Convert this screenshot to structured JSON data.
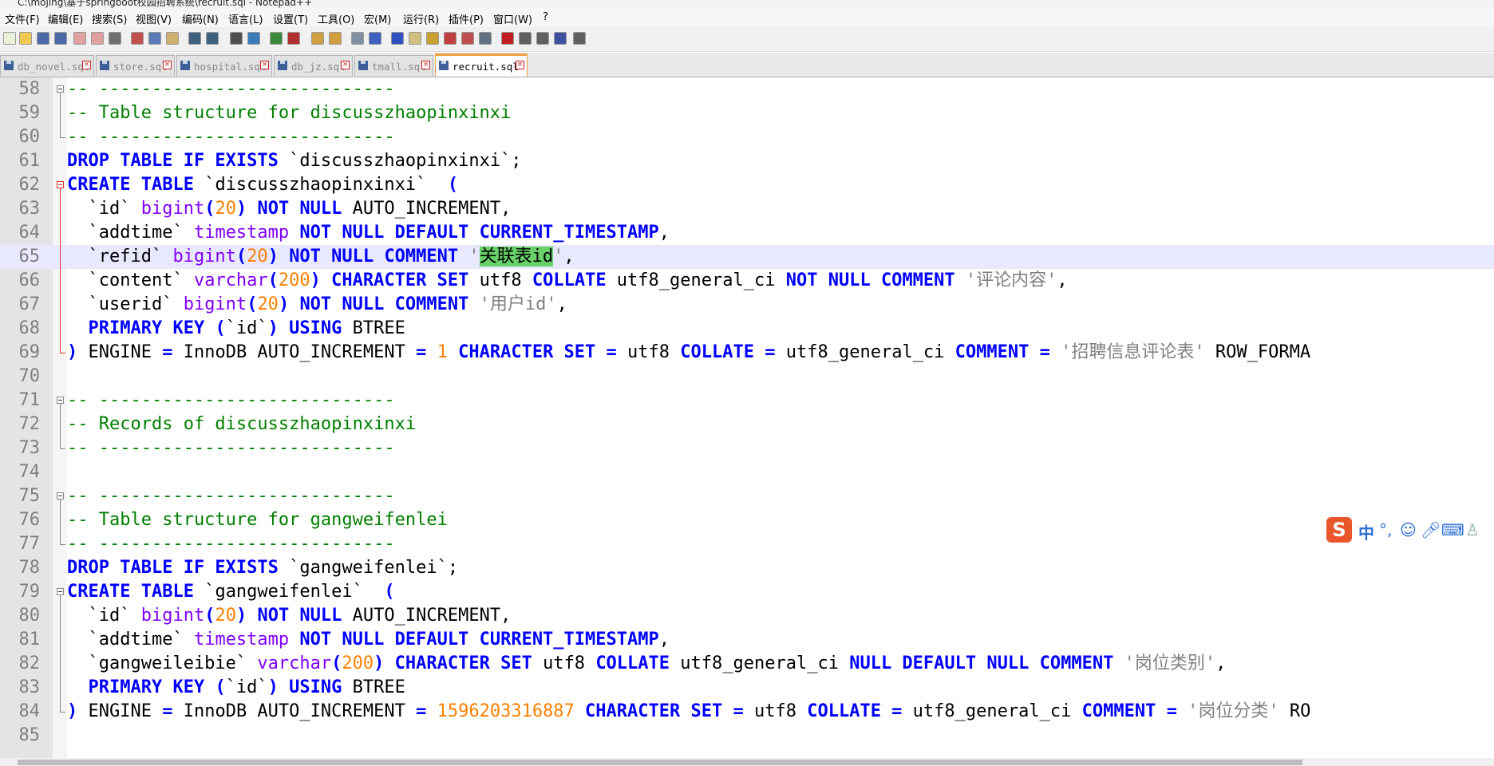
{
  "window": {
    "title": "C:\\mojing\\基于springboot校园招聘系统\\recruit.sql - Notepad++"
  },
  "menu": [
    "文件(F)",
    "编辑(E)",
    "搜索(S)",
    "视图(V)",
    "编码(N)",
    "语言(L)",
    "设置(T)",
    "工具(O)",
    "宏(M)",
    "运行(R)",
    "插件(P)",
    "窗口(W)",
    "?"
  ],
  "toolbar": {
    "icons": [
      "new-file-icon",
      "open-file-icon",
      "save-icon",
      "save-all-icon",
      "close-icon",
      "close-all-icon",
      "print-icon",
      "cut-icon",
      "copy-icon",
      "paste-icon",
      "undo-icon",
      "redo-icon",
      "find-icon",
      "replace-icon",
      "zoom-in-icon",
      "zoom-out-icon",
      "sync-vertical-icon",
      "sync-horizontal-icon",
      "word-wrap-icon",
      "show-all-chars-icon",
      "indent-guide-icon",
      "language-icon",
      "function-list-icon",
      "doc-map-icon",
      "folder-icon",
      "monitor-icon",
      "record-macro-icon",
      "stop-macro-icon",
      "play-macro-icon",
      "run-macro-multiple-icon",
      "save-macro-icon"
    ]
  },
  "tabs": [
    {
      "label": "db_novel.sql",
      "active": false
    },
    {
      "label": "store.sql",
      "active": false
    },
    {
      "label": "hospital.sql",
      "active": false
    },
    {
      "label": "db_jz.sql",
      "active": false
    },
    {
      "label": "tmall.sql",
      "active": false
    },
    {
      "label": "recruit.sql",
      "active": true
    }
  ],
  "editor": {
    "current_line": 65,
    "lines": [
      {
        "n": "58",
        "t": [
          [
            "c",
            "-- ----------------------------"
          ]
        ]
      },
      {
        "n": "59",
        "t": [
          [
            "c",
            "-- Table structure for discusszhaopinxinxi"
          ]
        ]
      },
      {
        "n": "60",
        "t": [
          [
            "c",
            "-- ----------------------------"
          ]
        ]
      },
      {
        "n": "61",
        "t": [
          [
            "k",
            "DROP TABLE IF EXISTS"
          ],
          [
            "p",
            " `discusszhaopinxinxi`;"
          ]
        ]
      },
      {
        "n": "62",
        "t": [
          [
            "k",
            "CREATE TABLE"
          ],
          [
            "p",
            " `discusszhaopinxinxi`  "
          ],
          [
            "k",
            "("
          ]
        ]
      },
      {
        "n": "63",
        "t": [
          [
            "p",
            "  `id` "
          ],
          [
            "ty",
            "bigint"
          ],
          [
            "k",
            "("
          ],
          [
            "n",
            "20"
          ],
          [
            "k",
            ")"
          ],
          [
            "p",
            " "
          ],
          [
            "k",
            "NOT NULL"
          ],
          [
            "p",
            " AUTO_INCREMENT,"
          ]
        ]
      },
      {
        "n": "64",
        "t": [
          [
            "p",
            "  `addtime` "
          ],
          [
            "ty",
            "timestamp"
          ],
          [
            "p",
            " "
          ],
          [
            "k",
            "NOT NULL DEFAULT CURRENT_TIMESTAMP"
          ],
          [
            "p",
            ","
          ]
        ]
      },
      {
        "n": "65",
        "t": [
          [
            "p",
            "  `refid` "
          ],
          [
            "ty",
            "bigint"
          ],
          [
            "k",
            "("
          ],
          [
            "n",
            "20"
          ],
          [
            "k",
            ")"
          ],
          [
            "p",
            " "
          ],
          [
            "k",
            "NOT NULL COMMENT"
          ],
          [
            "p",
            " "
          ],
          [
            "s",
            "'"
          ],
          [
            "hl",
            "关联表id"
          ],
          [
            "s",
            "'"
          ],
          [
            "p",
            ","
          ]
        ]
      },
      {
        "n": "66",
        "t": [
          [
            "p",
            "  `content` "
          ],
          [
            "ty",
            "varchar"
          ],
          [
            "k",
            "("
          ],
          [
            "n",
            "200"
          ],
          [
            "k",
            ")"
          ],
          [
            "p",
            " "
          ],
          [
            "k",
            "CHARACTER SET"
          ],
          [
            "p",
            " utf8 "
          ],
          [
            "k",
            "COLLATE"
          ],
          [
            "p",
            " utf8_general_ci "
          ],
          [
            "k",
            "NOT NULL COMMENT"
          ],
          [
            "p",
            " "
          ],
          [
            "s",
            "'评论内容'"
          ],
          [
            "p",
            ","
          ]
        ]
      },
      {
        "n": "67",
        "t": [
          [
            "p",
            "  `userid` "
          ],
          [
            "ty",
            "bigint"
          ],
          [
            "k",
            "("
          ],
          [
            "n",
            "20"
          ],
          [
            "k",
            ")"
          ],
          [
            "p",
            " "
          ],
          [
            "k",
            "NOT NULL COMMENT"
          ],
          [
            "p",
            " "
          ],
          [
            "s",
            "'用户id'"
          ],
          [
            "p",
            ","
          ]
        ]
      },
      {
        "n": "68",
        "t": [
          [
            "p",
            "  "
          ],
          [
            "k",
            "PRIMARY KEY ("
          ],
          [
            "p",
            "`id`"
          ],
          [
            "k",
            ") USING"
          ],
          [
            "p",
            " BTREE"
          ]
        ]
      },
      {
        "n": "69",
        "t": [
          [
            "k",
            ")"
          ],
          [
            "p",
            " ENGINE "
          ],
          [
            "k",
            "="
          ],
          [
            "p",
            " InnoDB AUTO_INCREMENT "
          ],
          [
            "k",
            "="
          ],
          [
            "p",
            " "
          ],
          [
            "n",
            "1"
          ],
          [
            "p",
            " "
          ],
          [
            "k",
            "CHARACTER SET ="
          ],
          [
            "p",
            " utf8 "
          ],
          [
            "k",
            "COLLATE ="
          ],
          [
            "p",
            " utf8_general_ci "
          ],
          [
            "k",
            "COMMENT ="
          ],
          [
            "p",
            " "
          ],
          [
            "s",
            "'招聘信息评论表'"
          ],
          [
            "p",
            " ROW_FORMA"
          ]
        ]
      },
      {
        "n": "70",
        "t": []
      },
      {
        "n": "71",
        "t": [
          [
            "c",
            "-- ----------------------------"
          ]
        ]
      },
      {
        "n": "72",
        "t": [
          [
            "c",
            "-- Records of discusszhaopinxinxi"
          ]
        ]
      },
      {
        "n": "73",
        "t": [
          [
            "c",
            "-- ----------------------------"
          ]
        ]
      },
      {
        "n": "74",
        "t": []
      },
      {
        "n": "75",
        "t": [
          [
            "c",
            "-- ----------------------------"
          ]
        ]
      },
      {
        "n": "76",
        "t": [
          [
            "c",
            "-- Table structure for gangweifenlei"
          ]
        ]
      },
      {
        "n": "77",
        "t": [
          [
            "c",
            "-- ----------------------------"
          ]
        ]
      },
      {
        "n": "78",
        "t": [
          [
            "k",
            "DROP TABLE IF EXISTS"
          ],
          [
            "p",
            " `gangweifenlei`;"
          ]
        ]
      },
      {
        "n": "79",
        "t": [
          [
            "k",
            "CREATE TABLE"
          ],
          [
            "p",
            " `gangweifenlei`  "
          ],
          [
            "k",
            "("
          ]
        ]
      },
      {
        "n": "80",
        "t": [
          [
            "p",
            "  `id` "
          ],
          [
            "ty",
            "bigint"
          ],
          [
            "k",
            "("
          ],
          [
            "n",
            "20"
          ],
          [
            "k",
            ")"
          ],
          [
            "p",
            " "
          ],
          [
            "k",
            "NOT NULL"
          ],
          [
            "p",
            " AUTO_INCREMENT,"
          ]
        ]
      },
      {
        "n": "81",
        "t": [
          [
            "p",
            "  `addtime` "
          ],
          [
            "ty",
            "timestamp"
          ],
          [
            "p",
            " "
          ],
          [
            "k",
            "NOT NULL DEFAULT CURRENT_TIMESTAMP"
          ],
          [
            "p",
            ","
          ]
        ]
      },
      {
        "n": "82",
        "t": [
          [
            "p",
            "  `gangweileibie` "
          ],
          [
            "ty",
            "varchar"
          ],
          [
            "k",
            "("
          ],
          [
            "n",
            "200"
          ],
          [
            "k",
            ")"
          ],
          [
            "p",
            " "
          ],
          [
            "k",
            "CHARACTER SET"
          ],
          [
            "p",
            " utf8 "
          ],
          [
            "k",
            "COLLATE"
          ],
          [
            "p",
            " utf8_general_ci "
          ],
          [
            "k",
            "NULL DEFAULT NULL COMMENT"
          ],
          [
            "p",
            " "
          ],
          [
            "s",
            "'岗位类别'"
          ],
          [
            "p",
            ","
          ]
        ]
      },
      {
        "n": "83",
        "t": [
          [
            "p",
            "  "
          ],
          [
            "k",
            "PRIMARY KEY ("
          ],
          [
            "p",
            "`id`"
          ],
          [
            "k",
            ") USING"
          ],
          [
            "p",
            " BTREE"
          ]
        ]
      },
      {
        "n": "84",
        "t": [
          [
            "k",
            ")"
          ],
          [
            "p",
            " ENGINE "
          ],
          [
            "k",
            "="
          ],
          [
            "p",
            " InnoDB AUTO_INCREMENT "
          ],
          [
            "k",
            "="
          ],
          [
            "p",
            " "
          ],
          [
            "n",
            "1596203316887"
          ],
          [
            "p",
            " "
          ],
          [
            "k",
            "CHARACTER SET ="
          ],
          [
            "p",
            " utf8 "
          ],
          [
            "k",
            "COLLATE ="
          ],
          [
            "p",
            " utf8_general_ci "
          ],
          [
            "k",
            "COMMENT ="
          ],
          [
            "p",
            " "
          ],
          [
            "s",
            "'岗位分类'"
          ],
          [
            "p",
            " RO"
          ]
        ]
      },
      {
        "n": "85",
        "t": []
      }
    ]
  },
  "ime": {
    "mode": "中",
    "punct": "°,",
    "icons": [
      "sogou-logo-icon",
      "smiley-icon",
      "microphone-icon",
      "keyboard-icon",
      "user-icon"
    ]
  },
  "colors": {
    "keyword": "#0000ff",
    "comment": "#008000",
    "number": "#ff8000",
    "string": "#808080",
    "type": "#8000ff",
    "current_line": "#e8e8ff",
    "highlight": "#68d068",
    "active_tab": "#f0a040"
  }
}
